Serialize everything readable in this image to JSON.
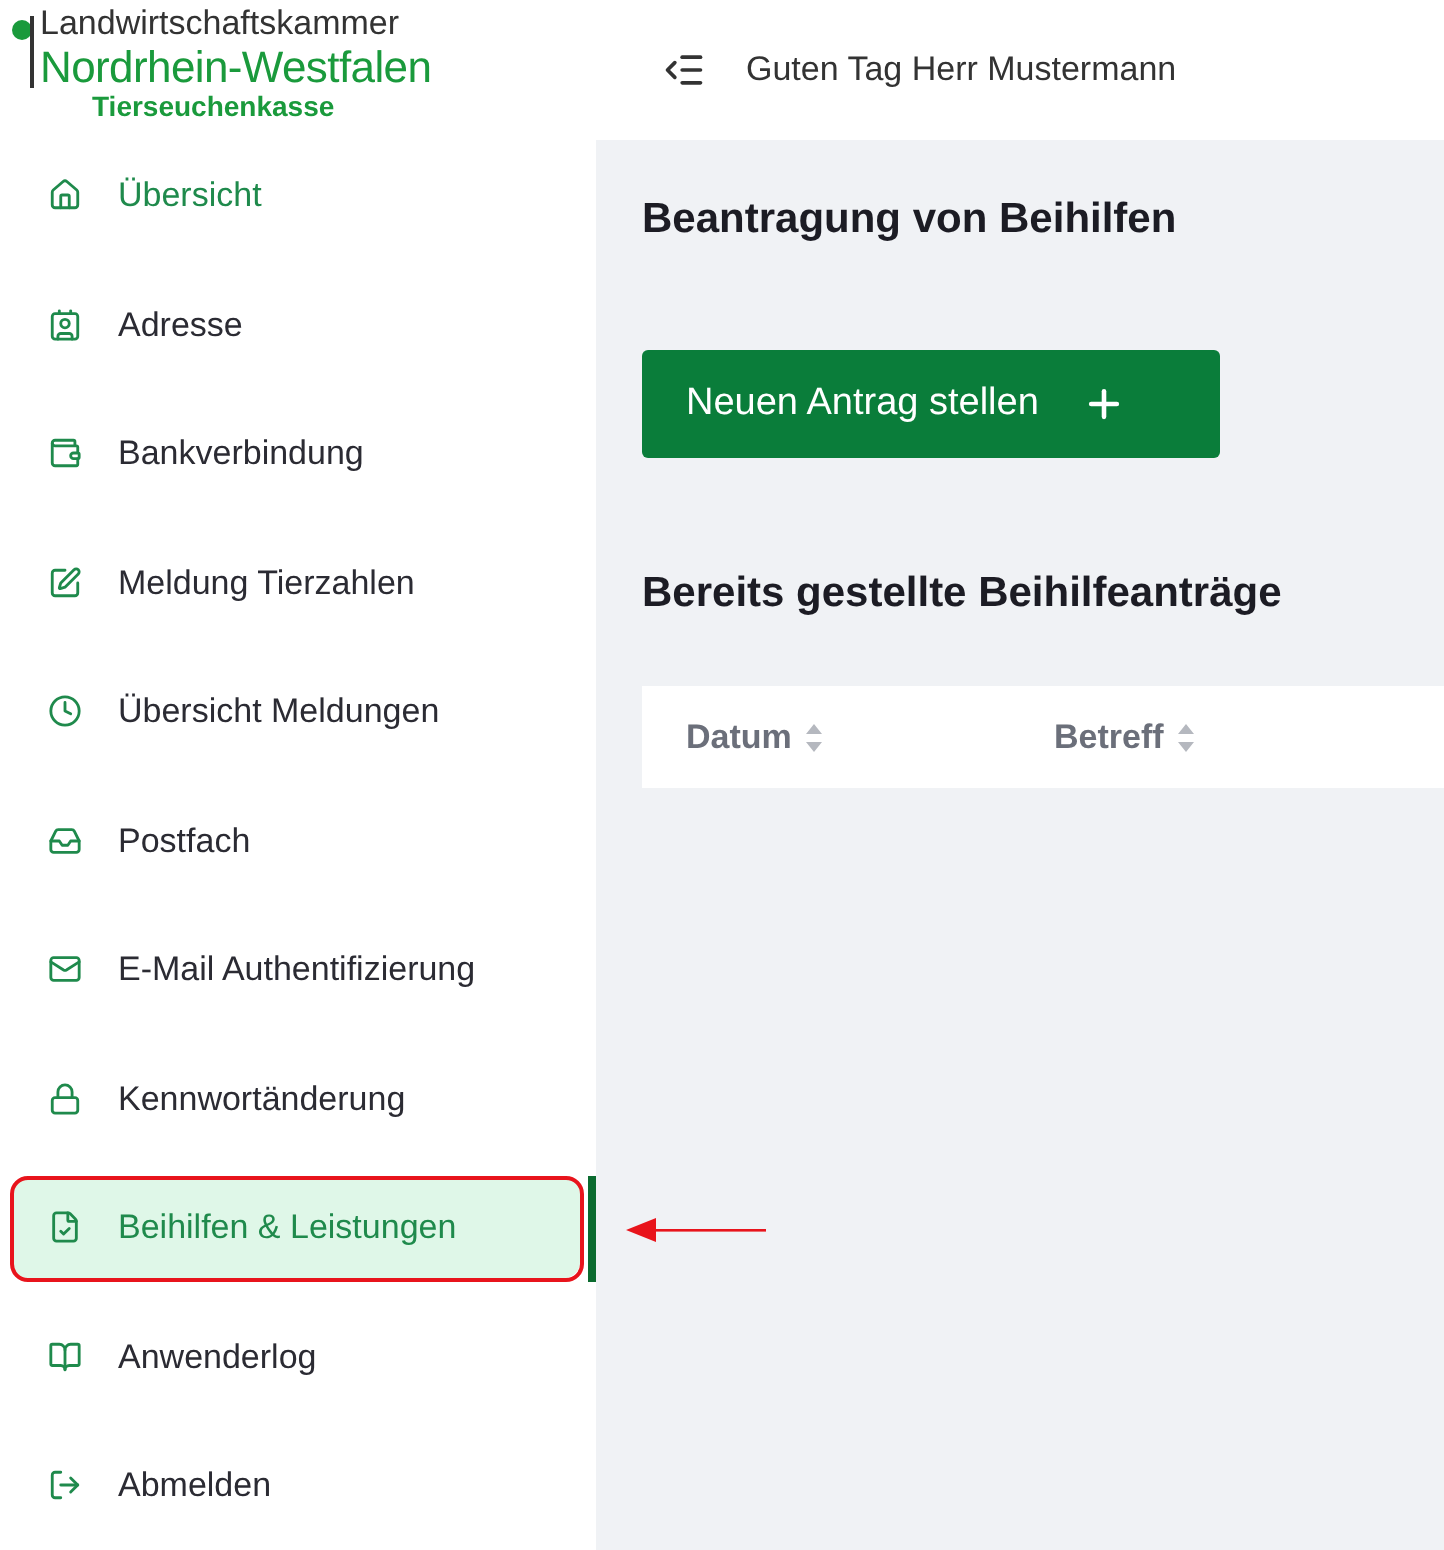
{
  "logo": {
    "line_1": "Landwirtschaftskammer",
    "line_2": "Nordrhein-Westfalen",
    "line_3": "Tierseuchenkasse"
  },
  "header": {
    "greeting": "Guten Tag Herr Mustermann"
  },
  "sidebar": {
    "items": [
      {
        "label": "Übersicht",
        "selected": false,
        "highlighted": true,
        "annotated": false
      },
      {
        "label": "Adresse",
        "selected": false,
        "highlighted": false,
        "annotated": false
      },
      {
        "label": "Bankverbindung",
        "selected": false,
        "highlighted": false,
        "annotated": false
      },
      {
        "label": "Meldung Tierzahlen",
        "selected": false,
        "highlighted": false,
        "annotated": false
      },
      {
        "label": "Übersicht Meldungen",
        "selected": false,
        "highlighted": false,
        "annotated": false
      },
      {
        "label": "Postfach",
        "selected": false,
        "highlighted": false,
        "annotated": false
      },
      {
        "label": "E-Mail Authentifizierung",
        "selected": false,
        "highlighted": false,
        "annotated": false
      },
      {
        "label": "Kennwortänderung",
        "selected": false,
        "highlighted": false,
        "annotated": false
      },
      {
        "label": "Beihilfen & Leistungen",
        "selected": true,
        "highlighted": true,
        "annotated": true
      },
      {
        "label": "Anwenderlog",
        "selected": false,
        "highlighted": false,
        "annotated": false
      },
      {
        "label": "Abmelden",
        "selected": false,
        "highlighted": false,
        "annotated": false
      }
    ]
  },
  "main": {
    "title": "Beantragung von Beihilfen",
    "new_button": "Neuen Antrag stellen",
    "section_title": "Bereits gestellte Beihilfeanträge",
    "table": {
      "columns": [
        "Datum",
        "Betreff"
      ]
    }
  }
}
